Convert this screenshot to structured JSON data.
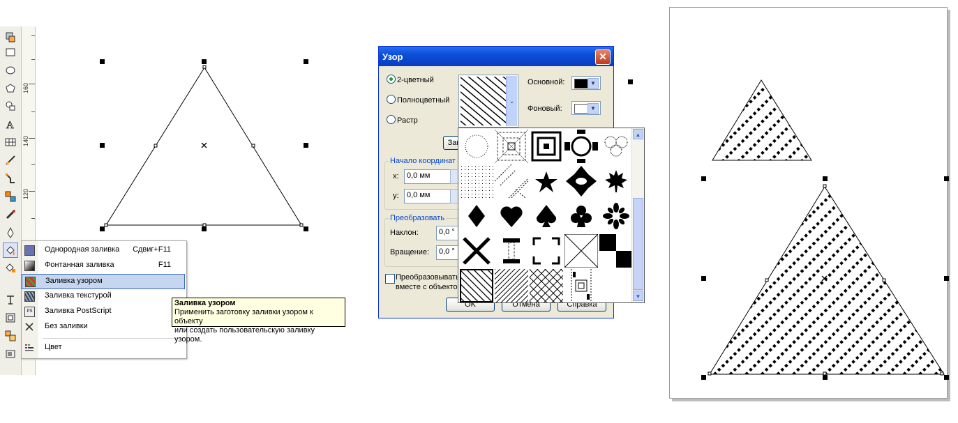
{
  "ruler": {
    "labels": [
      "160",
      "140",
      "120"
    ]
  },
  "flyout": {
    "items": [
      {
        "label": "Однородная заливка",
        "shortcut": "Сдвиг+F11",
        "icon": "uniform-fill-icon"
      },
      {
        "label": "Фонтанная заливка",
        "shortcut": "F11",
        "icon": "fountain-fill-icon"
      },
      {
        "label": "Заливка узором",
        "shortcut": "",
        "icon": "pattern-fill-icon"
      },
      {
        "label": "Заливка текстурой",
        "shortcut": "",
        "icon": "texture-fill-icon"
      },
      {
        "label": "Заливка PostScript",
        "shortcut": "",
        "icon": "postscript-fill-icon"
      },
      {
        "label": "Без заливки",
        "shortcut": "",
        "icon": "no-fill-icon"
      },
      {
        "label": "Цвет",
        "shortcut": "",
        "icon": "color-icon"
      }
    ]
  },
  "tooltip": {
    "title": "Заливка узором",
    "line1": "Применить заготовку заливки узором к объекту",
    "line2": "или создать пользовательскую заливку узором."
  },
  "dialog": {
    "title": "Узор",
    "radio_two_color": "2-цветный",
    "radio_full_color": "Полноцветный",
    "radio_bitmap": "Растр",
    "foreground_label": "Основной:",
    "background_label": "Фоновый:",
    "load_button": "Заг",
    "origin_group": "Начало координат",
    "x_label": "x:",
    "x_value": "0,0 мм",
    "y_label": "y:",
    "y_value": "0,0 мм",
    "transform_group": "Преобразовать",
    "skew_label": "Наклон:",
    "skew_value": "0,0 °",
    "rotate_label": "Вращение:",
    "rotate_value": "0,0 °",
    "transform_with_object_line1": "Преобразовывать",
    "transform_with_object_line2": "вместе с объекто",
    "ok_button": "OK",
    "cancel_button": "Отмена",
    "help_button": "Справка",
    "colors": {
      "foreground": "#000000",
      "background": "#ffffff"
    }
  }
}
